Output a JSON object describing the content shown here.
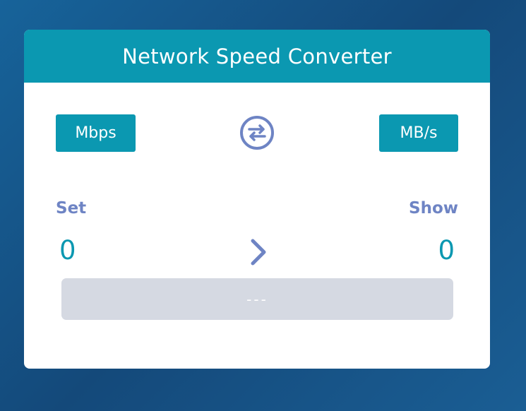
{
  "title": "Network Speed Converter",
  "units": {
    "from": "Mbps",
    "to": "MB/s"
  },
  "labels": {
    "set": "Set",
    "show": "Show"
  },
  "values": {
    "set": "0",
    "show": "0"
  },
  "result": "---",
  "icons": {
    "swap": "swap-arrows-icon",
    "arrow": "chevron-right-icon"
  },
  "colors": {
    "accent": "#0b98b1",
    "label": "#6e84c4",
    "result_bg": "#d5d9e2"
  }
}
